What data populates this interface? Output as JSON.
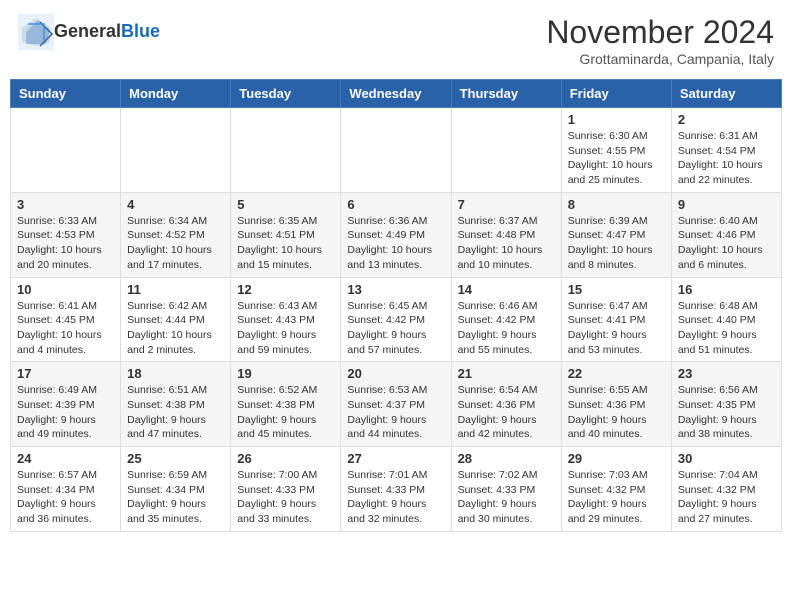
{
  "header": {
    "logo_general": "General",
    "logo_blue": "Blue",
    "month_title": "November 2024",
    "location": "Grottaminarda, Campania, Italy"
  },
  "weekdays": [
    "Sunday",
    "Monday",
    "Tuesday",
    "Wednesday",
    "Thursday",
    "Friday",
    "Saturday"
  ],
  "weeks": [
    [
      {
        "day": "",
        "info": ""
      },
      {
        "day": "",
        "info": ""
      },
      {
        "day": "",
        "info": ""
      },
      {
        "day": "",
        "info": ""
      },
      {
        "day": "",
        "info": ""
      },
      {
        "day": "1",
        "info": "Sunrise: 6:30 AM\nSunset: 4:55 PM\nDaylight: 10 hours\nand 25 minutes."
      },
      {
        "day": "2",
        "info": "Sunrise: 6:31 AM\nSunset: 4:54 PM\nDaylight: 10 hours\nand 22 minutes."
      }
    ],
    [
      {
        "day": "3",
        "info": "Sunrise: 6:33 AM\nSunset: 4:53 PM\nDaylight: 10 hours\nand 20 minutes."
      },
      {
        "day": "4",
        "info": "Sunrise: 6:34 AM\nSunset: 4:52 PM\nDaylight: 10 hours\nand 17 minutes."
      },
      {
        "day": "5",
        "info": "Sunrise: 6:35 AM\nSunset: 4:51 PM\nDaylight: 10 hours\nand 15 minutes."
      },
      {
        "day": "6",
        "info": "Sunrise: 6:36 AM\nSunset: 4:49 PM\nDaylight: 10 hours\nand 13 minutes."
      },
      {
        "day": "7",
        "info": "Sunrise: 6:37 AM\nSunset: 4:48 PM\nDaylight: 10 hours\nand 10 minutes."
      },
      {
        "day": "8",
        "info": "Sunrise: 6:39 AM\nSunset: 4:47 PM\nDaylight: 10 hours\nand 8 minutes."
      },
      {
        "day": "9",
        "info": "Sunrise: 6:40 AM\nSunset: 4:46 PM\nDaylight: 10 hours\nand 6 minutes."
      }
    ],
    [
      {
        "day": "10",
        "info": "Sunrise: 6:41 AM\nSunset: 4:45 PM\nDaylight: 10 hours\nand 4 minutes."
      },
      {
        "day": "11",
        "info": "Sunrise: 6:42 AM\nSunset: 4:44 PM\nDaylight: 10 hours\nand 2 minutes."
      },
      {
        "day": "12",
        "info": "Sunrise: 6:43 AM\nSunset: 4:43 PM\nDaylight: 9 hours\nand 59 minutes."
      },
      {
        "day": "13",
        "info": "Sunrise: 6:45 AM\nSunset: 4:42 PM\nDaylight: 9 hours\nand 57 minutes."
      },
      {
        "day": "14",
        "info": "Sunrise: 6:46 AM\nSunset: 4:42 PM\nDaylight: 9 hours\nand 55 minutes."
      },
      {
        "day": "15",
        "info": "Sunrise: 6:47 AM\nSunset: 4:41 PM\nDaylight: 9 hours\nand 53 minutes."
      },
      {
        "day": "16",
        "info": "Sunrise: 6:48 AM\nSunset: 4:40 PM\nDaylight: 9 hours\nand 51 minutes."
      }
    ],
    [
      {
        "day": "17",
        "info": "Sunrise: 6:49 AM\nSunset: 4:39 PM\nDaylight: 9 hours\nand 49 minutes."
      },
      {
        "day": "18",
        "info": "Sunrise: 6:51 AM\nSunset: 4:38 PM\nDaylight: 9 hours\nand 47 minutes."
      },
      {
        "day": "19",
        "info": "Sunrise: 6:52 AM\nSunset: 4:38 PM\nDaylight: 9 hours\nand 45 minutes."
      },
      {
        "day": "20",
        "info": "Sunrise: 6:53 AM\nSunset: 4:37 PM\nDaylight: 9 hours\nand 44 minutes."
      },
      {
        "day": "21",
        "info": "Sunrise: 6:54 AM\nSunset: 4:36 PM\nDaylight: 9 hours\nand 42 minutes."
      },
      {
        "day": "22",
        "info": "Sunrise: 6:55 AM\nSunset: 4:36 PM\nDaylight: 9 hours\nand 40 minutes."
      },
      {
        "day": "23",
        "info": "Sunrise: 6:56 AM\nSunset: 4:35 PM\nDaylight: 9 hours\nand 38 minutes."
      }
    ],
    [
      {
        "day": "24",
        "info": "Sunrise: 6:57 AM\nSunset: 4:34 PM\nDaylight: 9 hours\nand 36 minutes."
      },
      {
        "day": "25",
        "info": "Sunrise: 6:59 AM\nSunset: 4:34 PM\nDaylight: 9 hours\nand 35 minutes."
      },
      {
        "day": "26",
        "info": "Sunrise: 7:00 AM\nSunset: 4:33 PM\nDaylight: 9 hours\nand 33 minutes."
      },
      {
        "day": "27",
        "info": "Sunrise: 7:01 AM\nSunset: 4:33 PM\nDaylight: 9 hours\nand 32 minutes."
      },
      {
        "day": "28",
        "info": "Sunrise: 7:02 AM\nSunset: 4:33 PM\nDaylight: 9 hours\nand 30 minutes."
      },
      {
        "day": "29",
        "info": "Sunrise: 7:03 AM\nSunset: 4:32 PM\nDaylight: 9 hours\nand 29 minutes."
      },
      {
        "day": "30",
        "info": "Sunrise: 7:04 AM\nSunset: 4:32 PM\nDaylight: 9 hours\nand 27 minutes."
      }
    ]
  ]
}
